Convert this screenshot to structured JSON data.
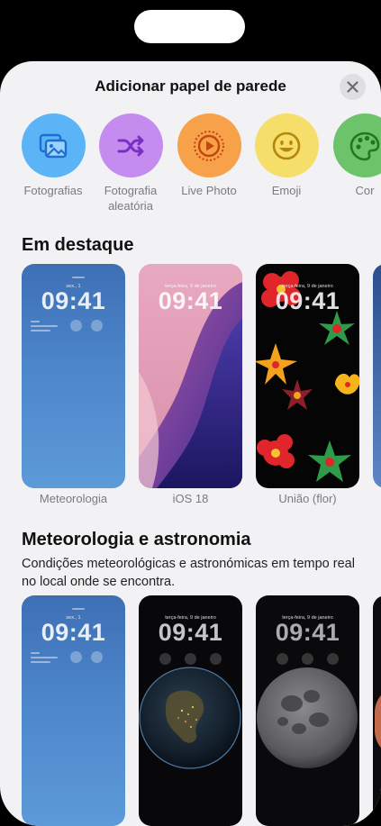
{
  "sheet": {
    "title": "Adicionar papel de parede",
    "close_icon": "xmark-icon"
  },
  "categories": [
    {
      "label": "Fotografias",
      "icon": "photos-icon",
      "color": "#5ab4f5"
    },
    {
      "label": "Fotografia aleatória",
      "icon": "shuffle-icon",
      "color": "#c58cf0"
    },
    {
      "label": "Live Photo",
      "icon": "live-photo-icon",
      "color": "#f7a14a"
    },
    {
      "label": "Emoji",
      "icon": "emoji-icon",
      "color": "#f5de6a"
    },
    {
      "label": "Cor",
      "icon": "palette-icon",
      "color": "#6cc36a"
    }
  ],
  "featured": {
    "title": "Em destaque",
    "cards": [
      {
        "label": "Meteorologia",
        "date": "sex., 1",
        "time": "09:41"
      },
      {
        "label": "iOS 18",
        "date": "terça-feira, 9 de janeiro",
        "time": "09:41"
      },
      {
        "label": "União (flor)",
        "date": "terça-feira, 9 de janeiro",
        "time": "09:41"
      }
    ]
  },
  "weather_astronomy": {
    "title": "Meteorologia e astronomia",
    "description": "Condições meteorológicas e astronómicas em tempo real no local onde se encontra.",
    "cards": [
      {
        "date": "sex., 1",
        "time": "09:41"
      },
      {
        "date": "terça-feira, 9 de janeiro",
        "time": "09:41"
      },
      {
        "date": "terça-feira, 9 de janeiro",
        "time": "09:41"
      }
    ]
  }
}
